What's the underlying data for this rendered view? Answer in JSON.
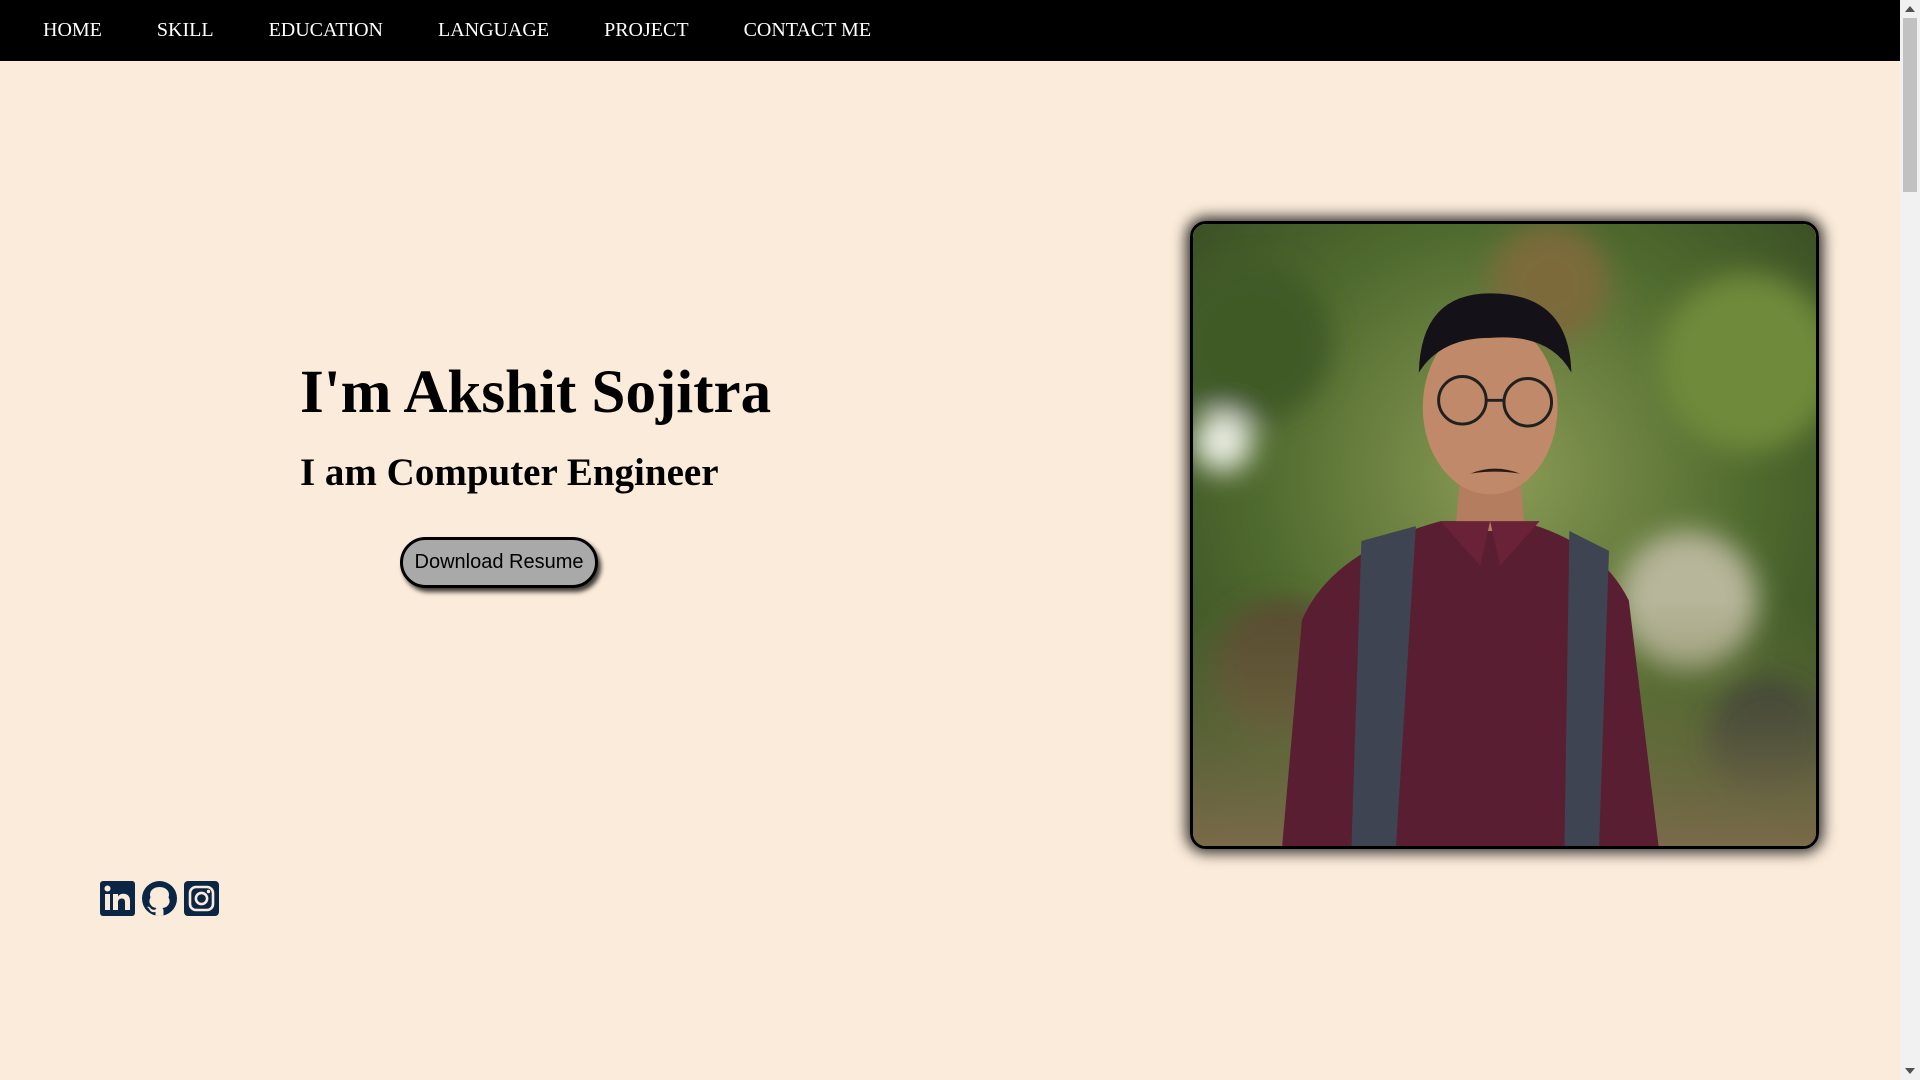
{
  "nav": {
    "items": [
      {
        "label": "HOME"
      },
      {
        "label": "SKILL"
      },
      {
        "label": "EDUCATION"
      },
      {
        "label": "LANGUAGE"
      },
      {
        "label": "PROJECT"
      },
      {
        "label": "CONTACT ME"
      }
    ]
  },
  "hero": {
    "name": "I'm Akshit Sojitra",
    "role": "I am Computer Engineer",
    "resume_button": "Download Resume"
  },
  "profile_photo": {
    "icon": "profile-photo"
  },
  "socials": [
    {
      "icon": "linkedin-icon"
    },
    {
      "icon": "github-icon"
    },
    {
      "icon": "instagram-icon"
    }
  ],
  "colors": {
    "background": "#fbebda",
    "navbar": "#000000",
    "nav_text": "#ffffff",
    "button": "#a9a9a9",
    "social_icon": "#0b2545"
  }
}
